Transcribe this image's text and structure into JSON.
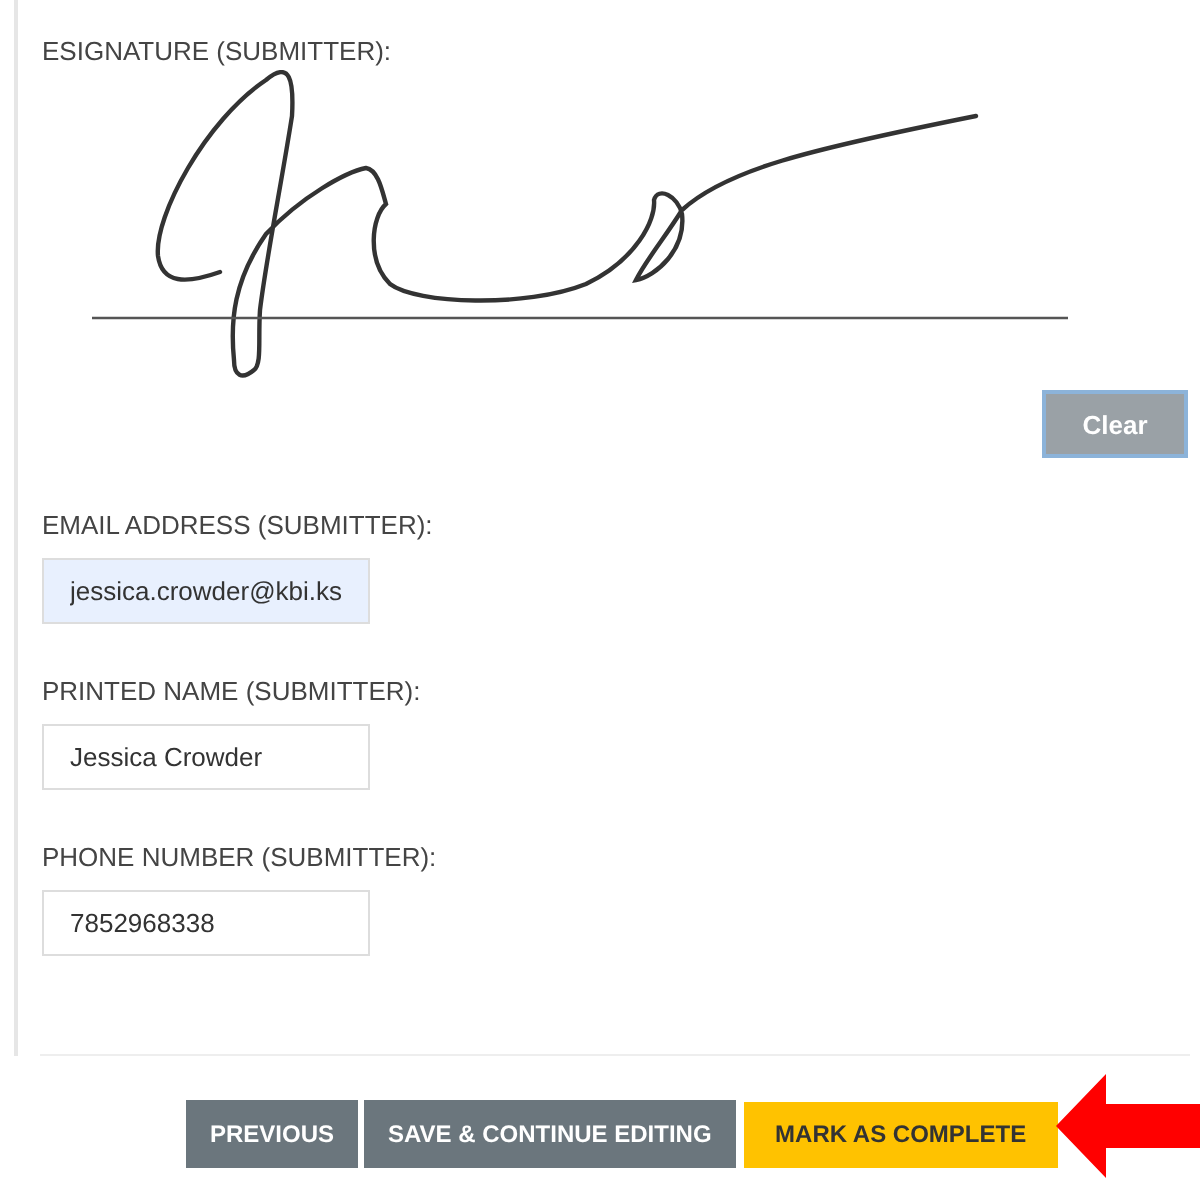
{
  "signature": {
    "label": "ESIGNATURE (SUBMITTER):",
    "clear_button": "Clear"
  },
  "fields": [
    {
      "label": "EMAIL ADDRESS (SUBMITTER):",
      "value": "jessica.crowder@kbi.ks",
      "autofilled": true
    },
    {
      "label": "PRINTED NAME (SUBMITTER):",
      "value": "Jessica Crowder",
      "autofilled": false
    },
    {
      "label": "PHONE NUMBER (SUBMITTER):",
      "value": "7852968338",
      "autofilled": false
    }
  ],
  "buttons": [
    {
      "label": "PREVIOUS",
      "kind": "secondary"
    },
    {
      "label": "SAVE & CONTINUE EDITING",
      "kind": "secondary"
    },
    {
      "label": "MARK AS COMPLETE",
      "kind": "primary"
    }
  ]
}
